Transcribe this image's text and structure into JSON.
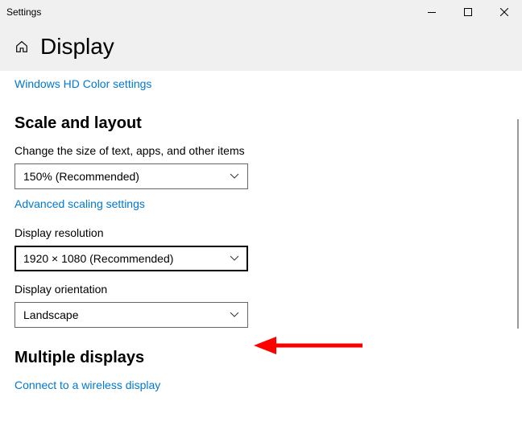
{
  "window": {
    "title": "Settings"
  },
  "header": {
    "page_title": "Display"
  },
  "links": {
    "hd_color": "Windows HD Color settings",
    "advanced_scaling": "Advanced scaling settings",
    "wireless_display": "Connect to a wireless display"
  },
  "sections": {
    "scale_layout": "Scale and layout",
    "multiple_displays": "Multiple displays"
  },
  "fields": {
    "scale": {
      "label": "Change the size of text, apps, and other items",
      "value": "150% (Recommended)"
    },
    "resolution": {
      "label": "Display resolution",
      "value": "1920 × 1080 (Recommended)"
    },
    "orientation": {
      "label": "Display orientation",
      "value": "Landscape"
    }
  },
  "colors": {
    "arrow": "#ff0000"
  }
}
